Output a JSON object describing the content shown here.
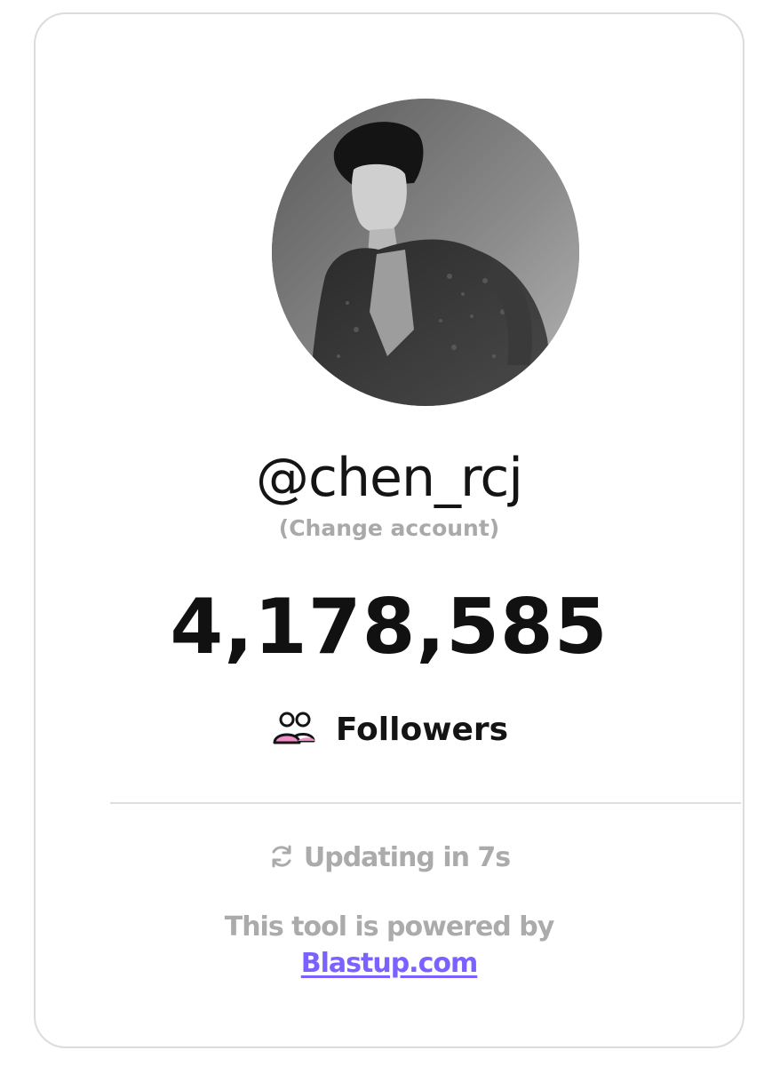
{
  "profile": {
    "username": "@chen_rcj",
    "change_account": "(Change account)"
  },
  "stats": {
    "follower_count": "4,178,585",
    "label": "Followers",
    "icon": "users-icon"
  },
  "status": {
    "updating": "Updating in 7s",
    "icon": "refresh-icon"
  },
  "footer": {
    "powered_by": "This tool is powered by",
    "link_text": "Blastup.com"
  },
  "colors": {
    "accent_link": "#7b61ff",
    "icon_pink": "#f58cc8",
    "muted_text": "#ababab"
  }
}
